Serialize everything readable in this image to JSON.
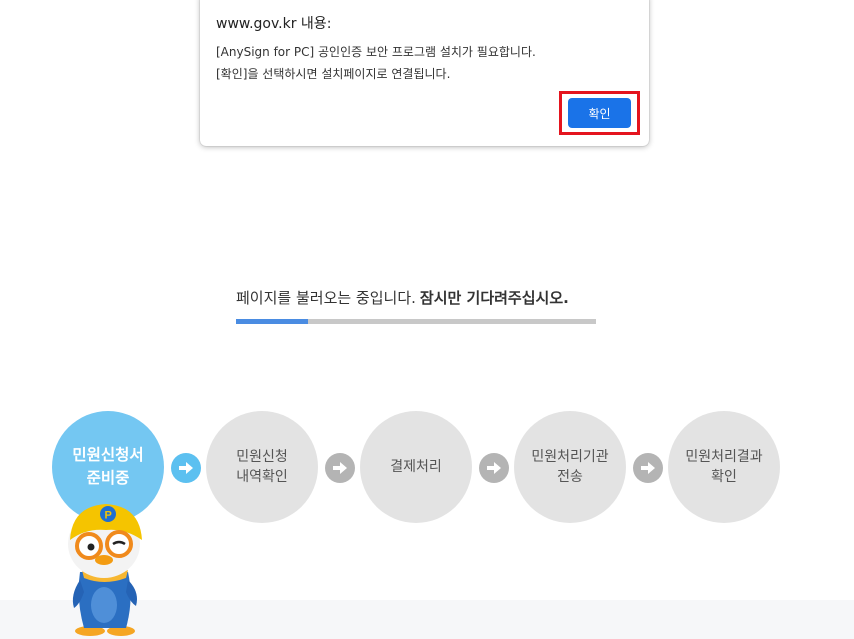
{
  "dialog": {
    "title": "www.gov.kr 내용:",
    "message_line1": "[AnySign for PC] 공인인증 보안 프로그램 설치가 필요합니다.",
    "message_line2": "[확인]을 선택하시면 설치페이지로 연결됩니다.",
    "ok_label": "확인"
  },
  "loading": {
    "text": "페이지를 불러오는 중입니다.",
    "text_strong": "잠시만 기다려주십시오.",
    "progress_fraction": 0.2
  },
  "steps": [
    {
      "line1": "민원신청서",
      "line2": "준비중",
      "active": true
    },
    {
      "line1": "민원신청",
      "line2": "내역확인",
      "active": false
    },
    {
      "line1": "결제처리",
      "line2": "",
      "active": false
    },
    {
      "line1": "민원처리기관",
      "line2": "전송",
      "active": false
    },
    {
      "line1": "민원처리결과",
      "line2": "확인",
      "active": false
    }
  ],
  "colors": {
    "ok_button": "#1a73e8",
    "highlight": "#e4141e",
    "active_step": "#74c7f2",
    "inactive_step": "#e3e3e3",
    "progress": "#4a8ce2"
  },
  "icons": {
    "step_arrow": "arrow-right-circle-icon",
    "mascot": "penguin-mascot-icon"
  }
}
